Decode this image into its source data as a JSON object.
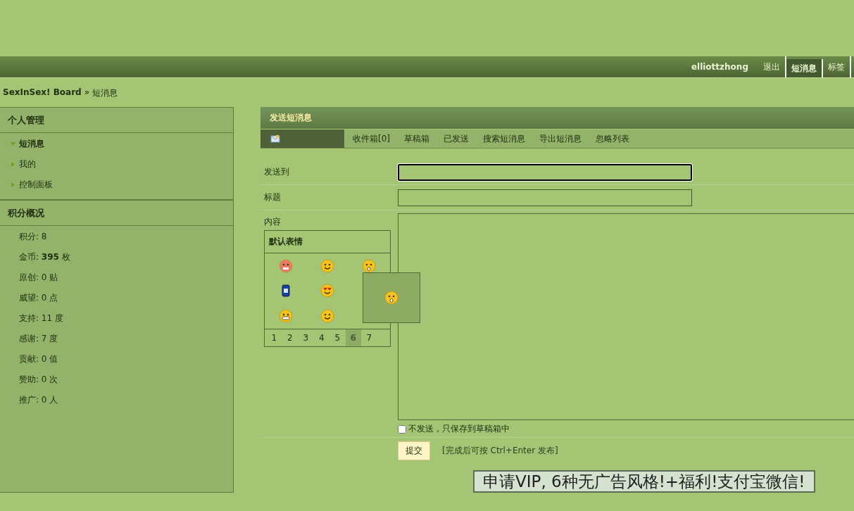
{
  "top_nav": {
    "user": "elliottzhong",
    "links": [
      {
        "label": "退出",
        "selected": false
      },
      {
        "label": "短消息",
        "selected": true
      },
      {
        "label": "标签",
        "selected": false
      }
    ]
  },
  "breadcrumb": {
    "home": "SexInSex! Board",
    "separator": "»",
    "current": "短消息"
  },
  "sidebar": {
    "sections": [
      {
        "title": "个人管理",
        "items": [
          {
            "label": "短消息",
            "expanded": true
          },
          {
            "label": "我的",
            "expanded": false
          },
          {
            "label": "控制面板",
            "expanded": false
          }
        ]
      },
      {
        "title": "积分概况",
        "stats": [
          "积分: 8",
          "金币: **395** 枚",
          "原创: 0 贴",
          "威望: 0 点",
          "支持: 11 度",
          "感谢: 7 度",
          "贡献: 0 值",
          "赞助: 0 次",
          "推广: 0 人"
        ]
      }
    ]
  },
  "panel": {
    "title": "发送短消息",
    "tabs": [
      {
        "kind": "icon",
        "selected": true
      },
      {
        "kind": "text",
        "label": "收件箱[0]",
        "selected": false
      },
      {
        "kind": "text",
        "label": "草稿箱",
        "selected": false
      },
      {
        "kind": "text",
        "label": "已发送",
        "selected": false
      },
      {
        "kind": "text",
        "label": "搜索短消息",
        "selected": false
      },
      {
        "kind": "text",
        "label": "导出短消息",
        "selected": false
      },
      {
        "kind": "text",
        "label": "忽略列表",
        "selected": false
      }
    ],
    "fields": [
      {
        "label": "发送到",
        "focused": true
      },
      {
        "label": "标题",
        "focused": false
      }
    ],
    "content_label": "内容",
    "smilies": {
      "title": "默认表情",
      "pages": [
        {
          "label": "1",
          "selected": false
        },
        {
          "label": "2",
          "selected": false
        },
        {
          "label": "3",
          "selected": false
        },
        {
          "label": "4",
          "selected": false
        },
        {
          "label": "5",
          "selected": false
        },
        {
          "label": "6",
          "selected": true
        },
        {
          "label": "7",
          "selected": false
        }
      ]
    },
    "draft_only": {
      "label": "不发送，只保存到草稿箱中",
      "checked": false
    },
    "submit": "提交",
    "hint": "[完成后可按 Ctrl+Enter 发布]"
  },
  "banner": "申请VIP, 6种无广告风格!+福利!支付宝微信!"
}
